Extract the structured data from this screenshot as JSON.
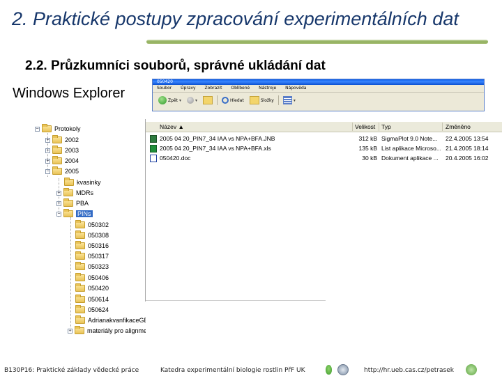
{
  "slide": {
    "title": "2. Praktické postupy zpracování experimentálních dat",
    "subtitle": "2.2. Průzkumníci souborů, správné ukládání dat",
    "label": "Windows Explorer"
  },
  "explorer": {
    "window_title": "050420",
    "menu": [
      "Soubor",
      "Úpravy",
      "Zobrazit",
      "Oblíbené",
      "Nástroje",
      "Nápověda"
    ],
    "toolbar": {
      "back": "Zpět",
      "search": "Hledat",
      "folders": "Složky"
    },
    "tree": [
      {
        "label": "Protokoly",
        "expander": "−"
      },
      {
        "label": "2002",
        "expander": "+"
      },
      {
        "label": "2003",
        "expander": "+"
      },
      {
        "label": "2004",
        "expander": "+"
      },
      {
        "label": "2005",
        "expander": "−"
      },
      {
        "label": "kvasinky",
        "expander": ""
      },
      {
        "label": "MDRs",
        "expander": "+"
      },
      {
        "label": "PBA",
        "expander": "+"
      },
      {
        "label": "PINs",
        "expander": "−",
        "selected": true
      },
      {
        "label": "050302",
        "expander": ""
      },
      {
        "label": "050308",
        "expander": ""
      },
      {
        "label": "050316",
        "expander": ""
      },
      {
        "label": "050317",
        "expander": ""
      },
      {
        "label": "050323",
        "expander": ""
      },
      {
        "label": "050406",
        "expander": ""
      },
      {
        "label": "050420",
        "expander": ""
      },
      {
        "label": "050614",
        "expander": ""
      },
      {
        "label": "050624",
        "expander": ""
      },
      {
        "label": "AdrianakvanfikaceGE",
        "expander": ""
      },
      {
        "label": "materiály pro alignme",
        "expander": "+"
      }
    ],
    "columns": {
      "name": "Název",
      "size": "Velikost",
      "type": "Typ",
      "modified": "Změněno"
    },
    "files": [
      {
        "name": "2005 04 20_PIN7_34 IAA vs NPA+BFA.JNB",
        "size": "312 kB",
        "type": "SigmaPlot 9.0 Note...",
        "modified": "22.4.2005 13:54",
        "icon": "sigmaplot-file-icon"
      },
      {
        "name": "2005 04 20_PIN7_34 IAA vs NPA+BFA.xls",
        "size": "135 kB",
        "type": "List aplikace Microso...",
        "modified": "21.4.2005 18:14",
        "icon": "excel-file-icon"
      },
      {
        "name": "050420.doc",
        "size": "30 kB",
        "type": "Dokument aplikace ...",
        "modified": "20.4.2005 16:02",
        "icon": "word-file-icon"
      }
    ]
  },
  "footer": {
    "course": "B130P16: Praktické základy vědecké práce",
    "department": "Katedra experimentální biologie rostlin PřF UK",
    "url": "http://hr.ueb.cas.cz/petrasek"
  }
}
